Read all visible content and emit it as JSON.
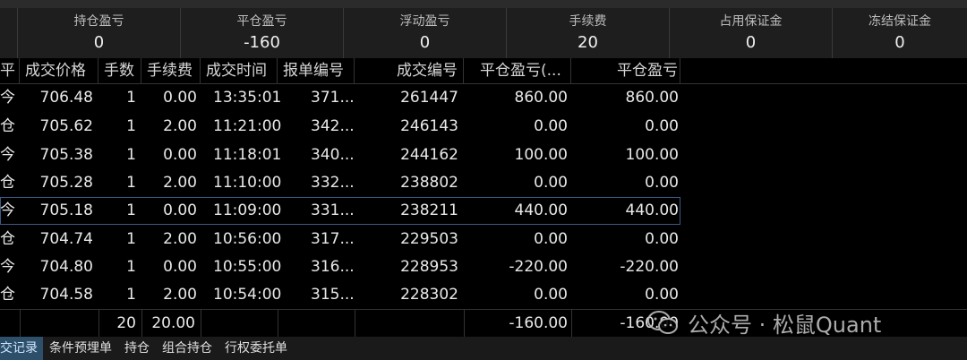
{
  "summary": [
    {
      "label": "持仓盈亏",
      "value": "0"
    },
    {
      "label": "平仓盈亏",
      "value": "-160"
    },
    {
      "label": "浮动盈亏",
      "value": "0"
    },
    {
      "label": "手续费",
      "value": "20"
    },
    {
      "label": "占用保证金",
      "value": "0"
    },
    {
      "label": "冻结保证金",
      "value": "0"
    }
  ],
  "columns": [
    "平",
    "成交价格",
    "手数",
    "手续费",
    "成交时间",
    "报单编号",
    "成交编号",
    "平仓盈亏(...",
    "平仓盈亏"
  ],
  "rows": [
    {
      "type": "今",
      "price": "706.48",
      "qty": "1",
      "fee": "0.00",
      "time": "13:35:01",
      "order": "371...",
      "trade": "261447",
      "pnl1": "860.00",
      "pnl2": "860.00"
    },
    {
      "type": "仓",
      "price": "705.62",
      "qty": "1",
      "fee": "2.00",
      "time": "11:21:00",
      "order": "342...",
      "trade": "246143",
      "pnl1": "0.00",
      "pnl2": "0.00"
    },
    {
      "type": "今",
      "price": "705.38",
      "qty": "1",
      "fee": "0.00",
      "time": "11:18:01",
      "order": "340...",
      "trade": "244162",
      "pnl1": "100.00",
      "pnl2": "100.00"
    },
    {
      "type": "仓",
      "price": "705.28",
      "qty": "1",
      "fee": "2.00",
      "time": "11:10:00",
      "order": "332...",
      "trade": "238802",
      "pnl1": "0.00",
      "pnl2": "0.00"
    },
    {
      "type": "今",
      "price": "705.18",
      "qty": "1",
      "fee": "0.00",
      "time": "11:09:00",
      "order": "331...",
      "trade": "238211",
      "pnl1": "440.00",
      "pnl2": "440.00"
    },
    {
      "type": "仓",
      "price": "704.74",
      "qty": "1",
      "fee": "2.00",
      "time": "10:56:00",
      "order": "317...",
      "trade": "229503",
      "pnl1": "0.00",
      "pnl2": "0.00"
    },
    {
      "type": "今",
      "price": "704.80",
      "qty": "1",
      "fee": "0.00",
      "time": "10:55:00",
      "order": "316...",
      "trade": "228953",
      "pnl1": "-220.00",
      "pnl2": "-220.00"
    },
    {
      "type": "仓",
      "price": "704.58",
      "qty": "1",
      "fee": "2.00",
      "time": "10:54:00",
      "order": "315...",
      "trade": "228302",
      "pnl1": "0.00",
      "pnl2": "0.00"
    }
  ],
  "totals": {
    "qty": "20",
    "fee": "20.00",
    "pnl1": "-160.00",
    "pnl2": "-160.00"
  },
  "tabs": [
    "交记录",
    "条件预埋单",
    "持仓",
    "组合持仓",
    "行权委托单"
  ],
  "watermark": "公众号 · 松鼠Quant",
  "colors": {
    "background": "#000000",
    "summary_bg": "#1e1e1e",
    "selection_border": "#3b5a86",
    "active_tab": "#2e4f6a"
  }
}
